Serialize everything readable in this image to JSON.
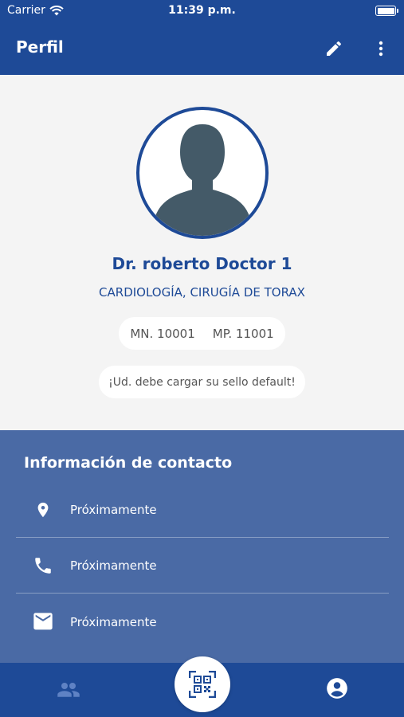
{
  "status_bar": {
    "carrier": "Carrier",
    "time": "11:39 p.m."
  },
  "app_bar": {
    "title": "Perfil",
    "edit_icon": "pencil-icon",
    "menu_icon": "more-vert-icon"
  },
  "profile": {
    "avatar_icon": "person-silhouette-icon",
    "name": "Dr. roberto Doctor 1",
    "specialty": "CARDIOLOGÍA, CIRUGÍA DE TORAX",
    "mn": "MN. 10001",
    "mp": "MP. 11001",
    "seal_notice": "¡Ud. debe cargar su sello default!"
  },
  "contact": {
    "title": "Información de contacto",
    "items": [
      {
        "icon": "location-pin-icon",
        "label": "Próximamente"
      },
      {
        "icon": "phone-icon",
        "label": "Próximamente"
      },
      {
        "icon": "mail-icon",
        "label": "Próximamente"
      }
    ]
  },
  "bottom_nav": {
    "left_icon": "people-icon",
    "center_icon": "qr-scan-icon",
    "right_icon": "account-circle-icon"
  },
  "colors": {
    "primary": "#1e4a97",
    "contact_bg": "#4a6aa5",
    "page_bg": "#f4f4f4"
  }
}
